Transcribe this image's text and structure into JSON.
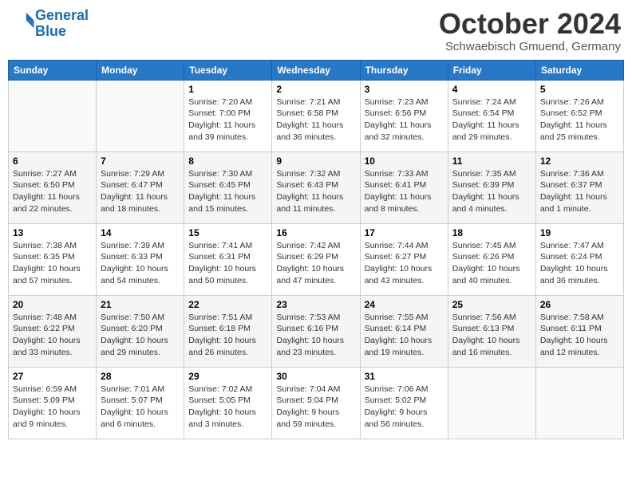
{
  "logo": {
    "line1": "General",
    "line2": "Blue"
  },
  "title": "October 2024",
  "location": "Schwaebisch Gmuend, Germany",
  "weekdays": [
    "Sunday",
    "Monday",
    "Tuesday",
    "Wednesday",
    "Thursday",
    "Friday",
    "Saturday"
  ],
  "weeks": [
    [
      {
        "day": "",
        "info": ""
      },
      {
        "day": "",
        "info": ""
      },
      {
        "day": "1",
        "info": "Sunrise: 7:20 AM\nSunset: 7:00 PM\nDaylight: 11 hours and 39 minutes."
      },
      {
        "day": "2",
        "info": "Sunrise: 7:21 AM\nSunset: 6:58 PM\nDaylight: 11 hours and 36 minutes."
      },
      {
        "day": "3",
        "info": "Sunrise: 7:23 AM\nSunset: 6:56 PM\nDaylight: 11 hours and 32 minutes."
      },
      {
        "day": "4",
        "info": "Sunrise: 7:24 AM\nSunset: 6:54 PM\nDaylight: 11 hours and 29 minutes."
      },
      {
        "day": "5",
        "info": "Sunrise: 7:26 AM\nSunset: 6:52 PM\nDaylight: 11 hours and 25 minutes."
      }
    ],
    [
      {
        "day": "6",
        "info": "Sunrise: 7:27 AM\nSunset: 6:50 PM\nDaylight: 11 hours and 22 minutes."
      },
      {
        "day": "7",
        "info": "Sunrise: 7:29 AM\nSunset: 6:47 PM\nDaylight: 11 hours and 18 minutes."
      },
      {
        "day": "8",
        "info": "Sunrise: 7:30 AM\nSunset: 6:45 PM\nDaylight: 11 hours and 15 minutes."
      },
      {
        "day": "9",
        "info": "Sunrise: 7:32 AM\nSunset: 6:43 PM\nDaylight: 11 hours and 11 minutes."
      },
      {
        "day": "10",
        "info": "Sunrise: 7:33 AM\nSunset: 6:41 PM\nDaylight: 11 hours and 8 minutes."
      },
      {
        "day": "11",
        "info": "Sunrise: 7:35 AM\nSunset: 6:39 PM\nDaylight: 11 hours and 4 minutes."
      },
      {
        "day": "12",
        "info": "Sunrise: 7:36 AM\nSunset: 6:37 PM\nDaylight: 11 hours and 1 minute."
      }
    ],
    [
      {
        "day": "13",
        "info": "Sunrise: 7:38 AM\nSunset: 6:35 PM\nDaylight: 10 hours and 57 minutes."
      },
      {
        "day": "14",
        "info": "Sunrise: 7:39 AM\nSunset: 6:33 PM\nDaylight: 10 hours and 54 minutes."
      },
      {
        "day": "15",
        "info": "Sunrise: 7:41 AM\nSunset: 6:31 PM\nDaylight: 10 hours and 50 minutes."
      },
      {
        "day": "16",
        "info": "Sunrise: 7:42 AM\nSunset: 6:29 PM\nDaylight: 10 hours and 47 minutes."
      },
      {
        "day": "17",
        "info": "Sunrise: 7:44 AM\nSunset: 6:27 PM\nDaylight: 10 hours and 43 minutes."
      },
      {
        "day": "18",
        "info": "Sunrise: 7:45 AM\nSunset: 6:26 PM\nDaylight: 10 hours and 40 minutes."
      },
      {
        "day": "19",
        "info": "Sunrise: 7:47 AM\nSunset: 6:24 PM\nDaylight: 10 hours and 36 minutes."
      }
    ],
    [
      {
        "day": "20",
        "info": "Sunrise: 7:48 AM\nSunset: 6:22 PM\nDaylight: 10 hours and 33 minutes."
      },
      {
        "day": "21",
        "info": "Sunrise: 7:50 AM\nSunset: 6:20 PM\nDaylight: 10 hours and 29 minutes."
      },
      {
        "day": "22",
        "info": "Sunrise: 7:51 AM\nSunset: 6:18 PM\nDaylight: 10 hours and 26 minutes."
      },
      {
        "day": "23",
        "info": "Sunrise: 7:53 AM\nSunset: 6:16 PM\nDaylight: 10 hours and 23 minutes."
      },
      {
        "day": "24",
        "info": "Sunrise: 7:55 AM\nSunset: 6:14 PM\nDaylight: 10 hours and 19 minutes."
      },
      {
        "day": "25",
        "info": "Sunrise: 7:56 AM\nSunset: 6:13 PM\nDaylight: 10 hours and 16 minutes."
      },
      {
        "day": "26",
        "info": "Sunrise: 7:58 AM\nSunset: 6:11 PM\nDaylight: 10 hours and 12 minutes."
      }
    ],
    [
      {
        "day": "27",
        "info": "Sunrise: 6:59 AM\nSunset: 5:09 PM\nDaylight: 10 hours and 9 minutes."
      },
      {
        "day": "28",
        "info": "Sunrise: 7:01 AM\nSunset: 5:07 PM\nDaylight: 10 hours and 6 minutes."
      },
      {
        "day": "29",
        "info": "Sunrise: 7:02 AM\nSunset: 5:05 PM\nDaylight: 10 hours and 3 minutes."
      },
      {
        "day": "30",
        "info": "Sunrise: 7:04 AM\nSunset: 5:04 PM\nDaylight: 9 hours and 59 minutes."
      },
      {
        "day": "31",
        "info": "Sunrise: 7:06 AM\nSunset: 5:02 PM\nDaylight: 9 hours and 56 minutes."
      },
      {
        "day": "",
        "info": ""
      },
      {
        "day": "",
        "info": ""
      }
    ]
  ]
}
